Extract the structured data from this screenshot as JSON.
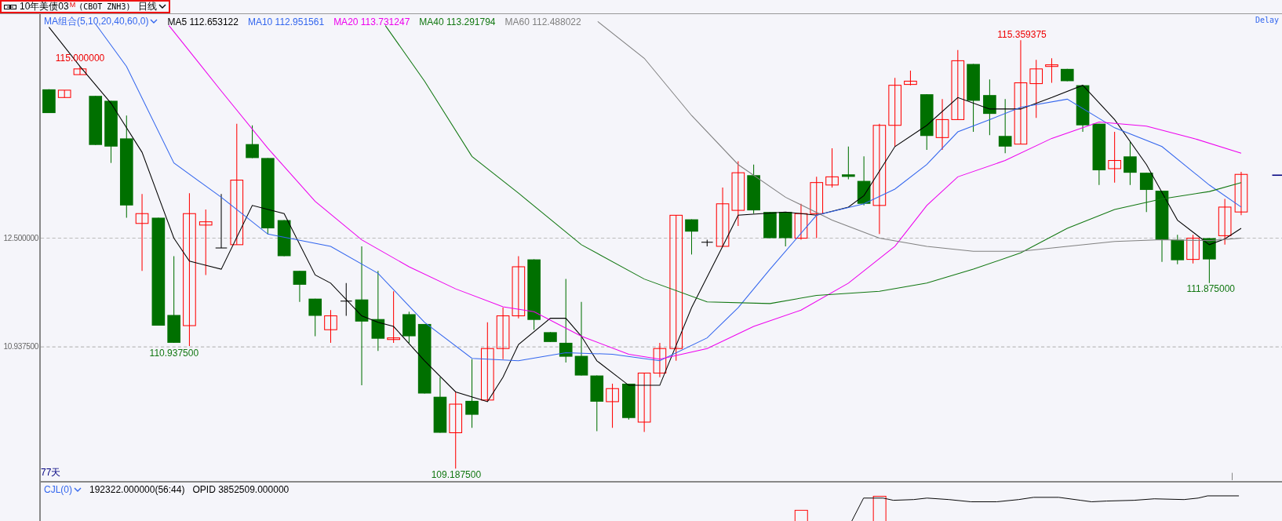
{
  "header": {
    "title": "10年美债03",
    "title_mark": "M",
    "symbol": "(CBOT ZNH3)",
    "period": "日线",
    "highlighted": true
  },
  "indicator_legend": {
    "label": "MA组合(5,10,20,40,60,0)",
    "items": [
      {
        "label": "MA5 112.653122",
        "color": "#000000"
      },
      {
        "label": "MA10 112.951561",
        "color": "#3366ee"
      },
      {
        "label": "MA20 113.731247",
        "color": "#ee00ee"
      },
      {
        "label": "MA40 113.291794",
        "color": "#117711"
      },
      {
        "label": "MA60 112.488022",
        "color": "#808080"
      }
    ]
  },
  "delay_label": "Delay",
  "axis_labels": [
    "12.500000",
    "10.937500"
  ],
  "price_labels": [
    {
      "text": "115.000000",
      "kind": "high"
    },
    {
      "text": "110.937500",
      "kind": "low"
    },
    {
      "text": "109.187500",
      "kind": "low"
    },
    {
      "text": "115.359375",
      "kind": "high"
    },
    {
      "text": "111.875000",
      "kind": "low"
    }
  ],
  "bar_count": "77天",
  "volume_panel": {
    "label": "CJL(0)",
    "readings": [
      "192322.000000(56:44)",
      "OPID 3852509.000000"
    ]
  }
}
